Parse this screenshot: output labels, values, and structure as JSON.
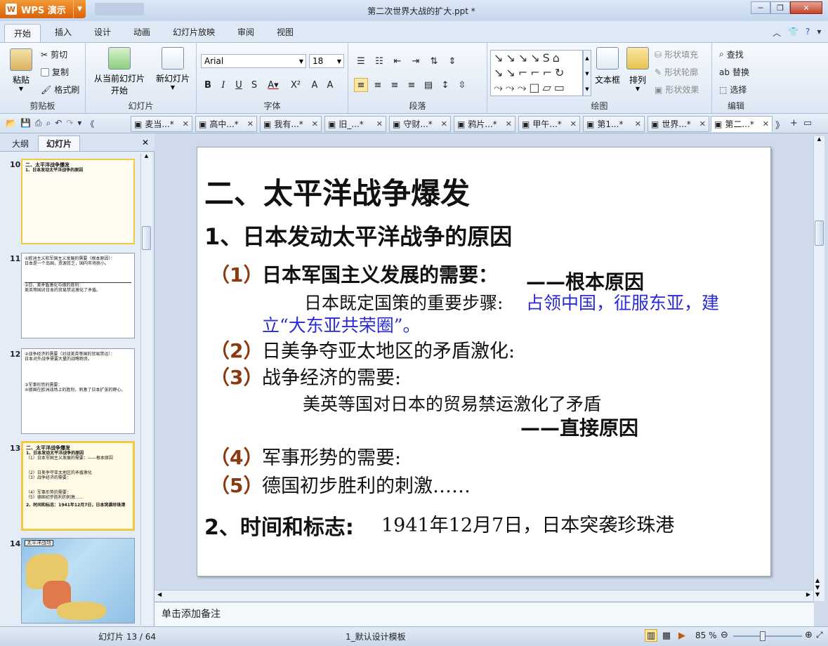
{
  "app": {
    "name": "WPS 演示",
    "doc_title": "第二次世界大战的扩大.ppt *"
  },
  "window_controls": {
    "minimize": "─",
    "restore": "❐",
    "close": "✕"
  },
  "ribbon_tabs": [
    "开始",
    "插入",
    "设计",
    "动画",
    "幻灯片放映",
    "审阅",
    "视图"
  ],
  "clipboard": {
    "paste": "粘贴",
    "cut": "剪切",
    "copy": "复制",
    "format_painter": "格式刷",
    "label": "剪贴板"
  },
  "slides_group": {
    "from_current": "从当前幻灯片",
    "start": "开始",
    "new_slide": "新幻灯片",
    "label": "幻灯片"
  },
  "font_group": {
    "font_name": "Arial",
    "font_size": "18",
    "label": "字体"
  },
  "paragraph_group": {
    "label": "段落"
  },
  "drawing_group": {
    "textbox": "文本框",
    "arrange": "排列",
    "shape_fill": "形状填充",
    "shape_outline": "形状轮廓",
    "shape_effect": "形状效果",
    "label": "绘图"
  },
  "edit_group": {
    "find": "查找",
    "replace": "替换",
    "select": "选择",
    "label": "编辑"
  },
  "doc_tabs": [
    "麦当...*",
    "高中...*",
    "我有...*",
    "旧_...*",
    "守财...*",
    "鸦片...*",
    "甲午...*",
    "第1...*",
    "世界...*",
    "第二...*"
  ],
  "left_panel": {
    "tab_outline": "大纲",
    "tab_slides": "幻灯片"
  },
  "thumbnails": [
    {
      "num": "10",
      "lines": [
        "二、太平洋战争爆发",
        "1、日本发动太平洋战争的原因"
      ]
    },
    {
      "num": "11",
      "lines": [
        "①欧洲主义和军国主义发展的需要（根本原因）：",
        "日本是一个岛国，资源贫乏，国内市场狭小。",
        "②日、美矛盾激化与德的胜利：",
        "美英等国对日本的贸易禁运激化了矛盾。"
      ]
    },
    {
      "num": "12",
      "lines": [
        "②战争经济的需要（对战美英等国的贸易禁运）：",
        "日本对外战争需要大量的战略物资。",
        "③军事形势的需要：",
        "④德国在欧洲战场上的胜利，刺激了日本扩张的野心。"
      ]
    },
    {
      "num": "13",
      "lines": [
        "二、太平洋战争爆发",
        "1、日本发动太平洋战争的原因",
        "（1）日本军国主义发展的需要：——根本原因",
        "（2）日美争夺亚太地区的矛盾激化",
        "（3）战争经济的需要：",
        "（4）军事形势的需要：",
        "（5）德国初步胜利的刺激……",
        "2、时间和标志：1941年12月7日，日本突袭珍珠港"
      ]
    },
    {
      "num": "14",
      "lines": [
        "太平洋战场"
      ]
    }
  ],
  "slide": {
    "title": "二、太平洋战争爆发",
    "h1": "1、日本发动太平洋战争的原因",
    "p1_num": "（1）",
    "p1": "日本军国主义发展的需要：",
    "p1_root": "——根本原因",
    "p1_detail_a": "日本既定国策的重要步骤:",
    "p1_detail_b": "占领中国，征服东亚，建",
    "p1_detail_c": "立“大东亚共荣圈”。",
    "p2_num": "（2）",
    "p2": "日美争夺亚太地区的矛盾激化:",
    "p3_num": "（3）",
    "p3": "战争经济的需要:",
    "p3_detail": "美英等国对日本的贸易禁运激化了矛盾",
    "p3_direct": "——直接原因",
    "p4_num": "（4）",
    "p4": "军事形势的需要:",
    "p5_num": "（5）",
    "p5": "德国初步胜利的刺激……",
    "h2": "2、时间和标志:",
    "h2_detail": "1941年12月7日，日本突袭珍珠港"
  },
  "notes_placeholder": "单击添加备注",
  "status": {
    "slide_counter": "幻灯片 13 / 64",
    "template": "1_默认设计模板",
    "zoom": "85 %"
  },
  "colors": {
    "accent_orange": "#8b3a0f",
    "blue_text": "#2a2ad6",
    "ribbon_bg": "#dce7f4"
  }
}
